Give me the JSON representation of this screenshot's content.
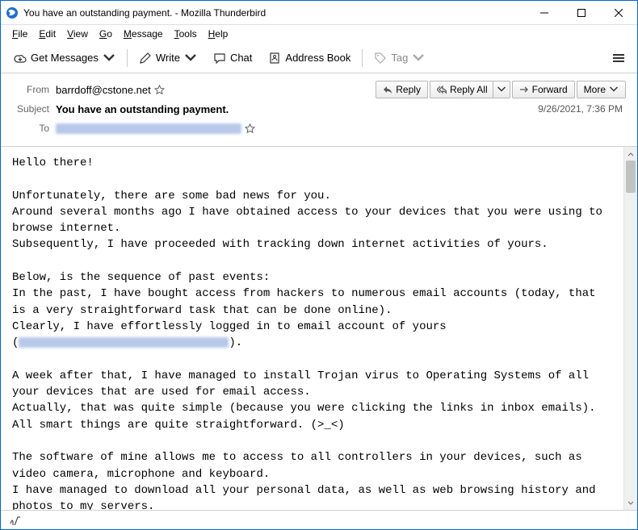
{
  "window": {
    "title": "You have an outstanding payment. - Mozilla Thunderbird"
  },
  "menu": {
    "file": "File",
    "edit": "Edit",
    "view": "View",
    "go": "Go",
    "message": "Message",
    "tools": "Tools",
    "help": "Help"
  },
  "toolbar": {
    "get_messages": "Get Messages",
    "write": "Write",
    "chat": "Chat",
    "address_book": "Address Book",
    "tag": "Tag"
  },
  "header": {
    "from_label": "From",
    "from_value": "barrdoff@cstone.net",
    "subject_label": "Subject",
    "subject_value": "You have an outstanding payment.",
    "to_label": "To",
    "date": "9/26/2021, 7:36 PM",
    "reply": "Reply",
    "reply_all": "Reply All",
    "forward": "Forward",
    "more": "More"
  },
  "body": {
    "p1": "Hello there!",
    "p2": "Unfortunately, there are some bad news for you.\nAround several months ago I have obtained access to your devices that you were using to browse internet.\nSubsequently, I have proceeded with tracking down internet activities of yours.",
    "p3": "Below, is the sequence of past events:\nIn the past, I have bought access from hackers to numerous email accounts (today, that is a very straightforward task that can be done online).\nClearly, I have effortlessly logged in to email account of yours\n(",
    "p3b": ").",
    "p4": "A week after that, I have managed to install Trojan virus to Operating Systems of all your devices that are used for email access.\nActually, that was quite simple (because you were clicking the links in inbox emails).\nAll smart things are quite straightforward. (>_<)",
    "p5": "The software of mine allows me to access to all controllers in your devices, such as video camera, microphone and keyboard.\nI have managed to download all your personal data, as well as web browsing history and photos to my servers."
  }
}
